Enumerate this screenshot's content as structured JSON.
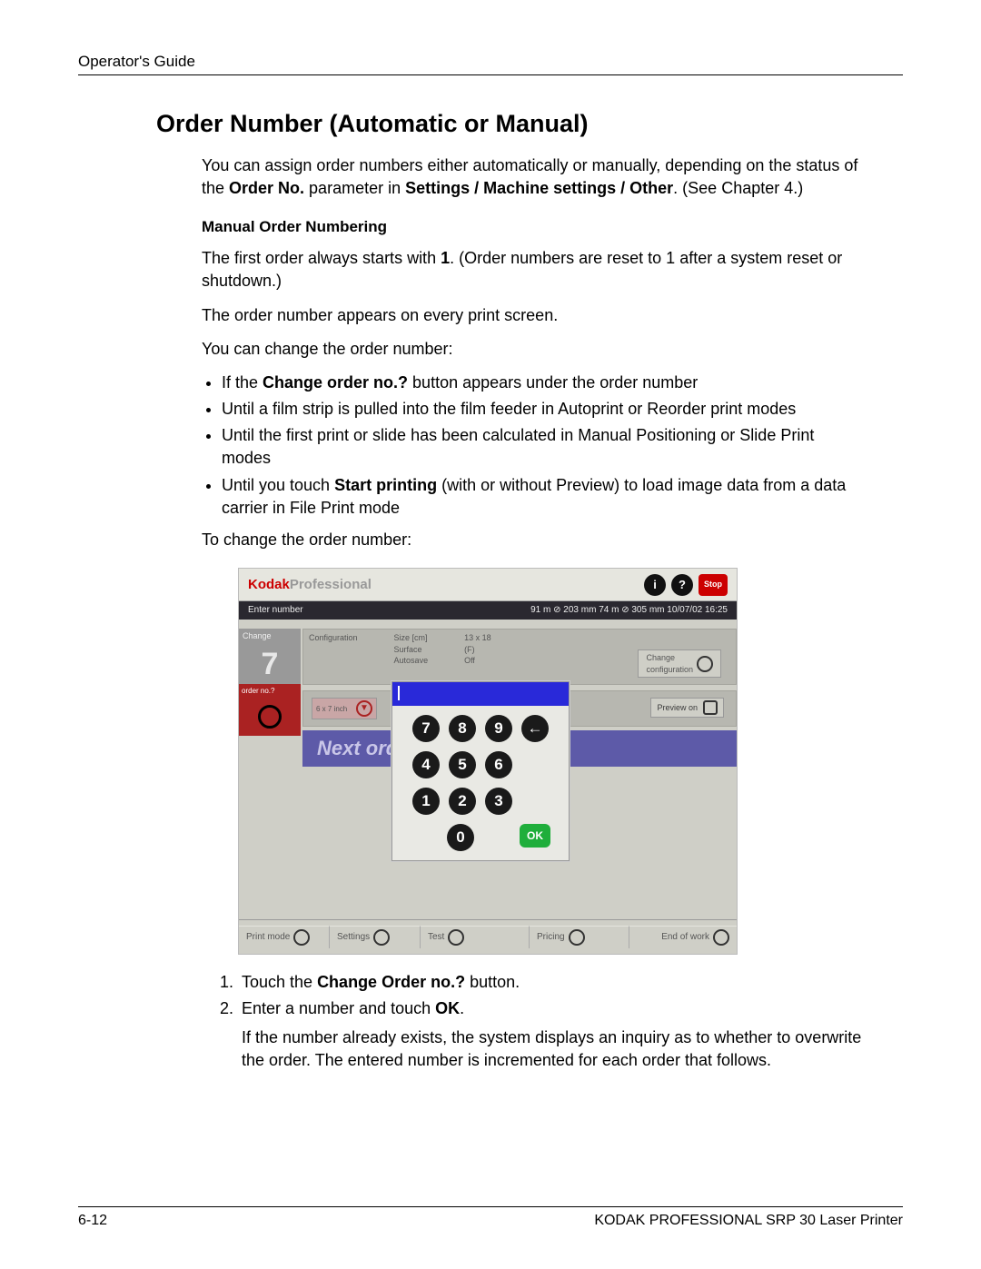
{
  "header": {
    "title": "Operator's Guide"
  },
  "heading": "Order Number (Automatic or Manual)",
  "intro": {
    "t1": "You can assign order numbers either automatically or manually, depending on the status of the ",
    "b1": "Order No.",
    "t2": " parameter in ",
    "b2": "Settings / Machine settings / Other",
    "t3": ". (See Chapter 4.)"
  },
  "sub1": "Manual Order Numbering",
  "p1": {
    "a": "The first order always starts with ",
    "b": "1",
    "c": ". (Order numbers are reset to 1 after a system reset or shutdown.)"
  },
  "p2": "The order number appears on every print screen.",
  "p3": "You can change the order number:",
  "bullets": {
    "b0a": "If the ",
    "b0b": "Change order no.?",
    "b0c": " button appears under the order number",
    "b1": "Until a film strip is pulled into the film feeder in Autoprint or Reorder print modes",
    "b2": "Until the first print or slide has been calculated in Manual Positioning or Slide Print modes",
    "b3a": "Until you touch ",
    "b3b": "Start printing",
    "b3c": " (with or without Preview) to load image data from a data carrier in File Print mode"
  },
  "p4": "To change the order number:",
  "steps": {
    "s1a": "Touch the ",
    "s1b": "Change Order no.?",
    "s1c": " button.",
    "s2a": "Enter a number and touch ",
    "s2b": "OK",
    "s2c": ".",
    "s2note": "If the number already exists, the system displays an inquiry as to whether to overwrite the order. The entered number is incremented for each order that follows."
  },
  "screenshot": {
    "brand_k": "Kodak",
    "brand_p": "Professional",
    "info_icon": "i",
    "help_icon": "?",
    "stop": "Stop",
    "status_left": "Enter number",
    "status_right": "91 m ⊘ 203 mm   74 m ⊘ 305 mm  10/07/02     16:25",
    "change_label": "Change",
    "change_num": "7",
    "order_tag": "order no.?",
    "cfg_title": "Configuration",
    "cfg_size": "Size [cm]",
    "cfg_size_v": "13 x 18",
    "cfg_surface": "Surface",
    "cfg_surface_v": "(F)",
    "cfg_autosave": "Autosave",
    "cfg_autosave_v": "Off",
    "cfg_change": "Change",
    "cfg_config": "configuration",
    "chip": "6 x 7 inch",
    "prev": "Preview on",
    "next_order": "Next order",
    "keypad": {
      "k7": "7",
      "k8": "8",
      "k9": "9",
      "bksp": "←",
      "k4": "4",
      "k5": "5",
      "k6": "6",
      "k1": "1",
      "k2": "2",
      "k3": "3",
      "k0": "0",
      "ok": "OK"
    },
    "bottom": {
      "print": "Print mode",
      "settings": "Settings",
      "test": "Test",
      "pricing": "Pricing",
      "end": "End of work"
    },
    "iguration": "iguration"
  },
  "footer": {
    "left": "6-12",
    "right": "KODAK PROFESSIONAL SRP 30 Laser Printer"
  }
}
